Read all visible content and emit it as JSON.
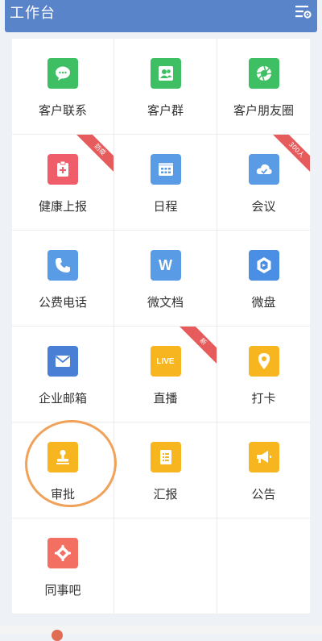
{
  "header": {
    "title": "工作台",
    "menu_icon": "list-settings-icon"
  },
  "apps": [
    {
      "label": "客户联系",
      "icon": "chat-bubble-icon",
      "color": "#3fbf63"
    },
    {
      "label": "客户群",
      "icon": "group-icon",
      "color": "#3fbf63"
    },
    {
      "label": "客户朋友圈",
      "icon": "aperture-icon",
      "color": "#3fbf63"
    },
    {
      "label": "健康上报",
      "icon": "health-report-icon",
      "color": "#ef5d6b",
      "badge": "防疫"
    },
    {
      "label": "日程",
      "icon": "calendar-icon",
      "color": "#5a9be6"
    },
    {
      "label": "会议",
      "icon": "cloud-icon",
      "color": "#5a9be6",
      "badge": "300人"
    },
    {
      "label": "公费电话",
      "icon": "phone-icon",
      "color": "#5a9be6"
    },
    {
      "label": "微文档",
      "icon": "document-w-icon",
      "color": "#5a9be6",
      "glyph": "W"
    },
    {
      "label": "微盘",
      "icon": "drive-icon",
      "color": "#4a8fe3"
    },
    {
      "label": "企业邮箱",
      "icon": "mail-icon",
      "color": "#4a7fd6"
    },
    {
      "label": "直播",
      "icon": "live-icon",
      "color": "#f7b520",
      "glyph": "LIVE",
      "badge": "新"
    },
    {
      "label": "打卡",
      "icon": "location-pin-icon",
      "color": "#f7b520"
    },
    {
      "label": "审批",
      "icon": "stamp-icon",
      "color": "#f7b520"
    },
    {
      "label": "汇报",
      "icon": "report-icon",
      "color": "#f7b520"
    },
    {
      "label": "公告",
      "icon": "megaphone-icon",
      "color": "#f7b520"
    },
    {
      "label": "同事吧",
      "icon": "colleague-bar-icon",
      "color": "#f36f62"
    }
  ],
  "annotation": {
    "color": "#f0a25b",
    "target": "审批"
  }
}
